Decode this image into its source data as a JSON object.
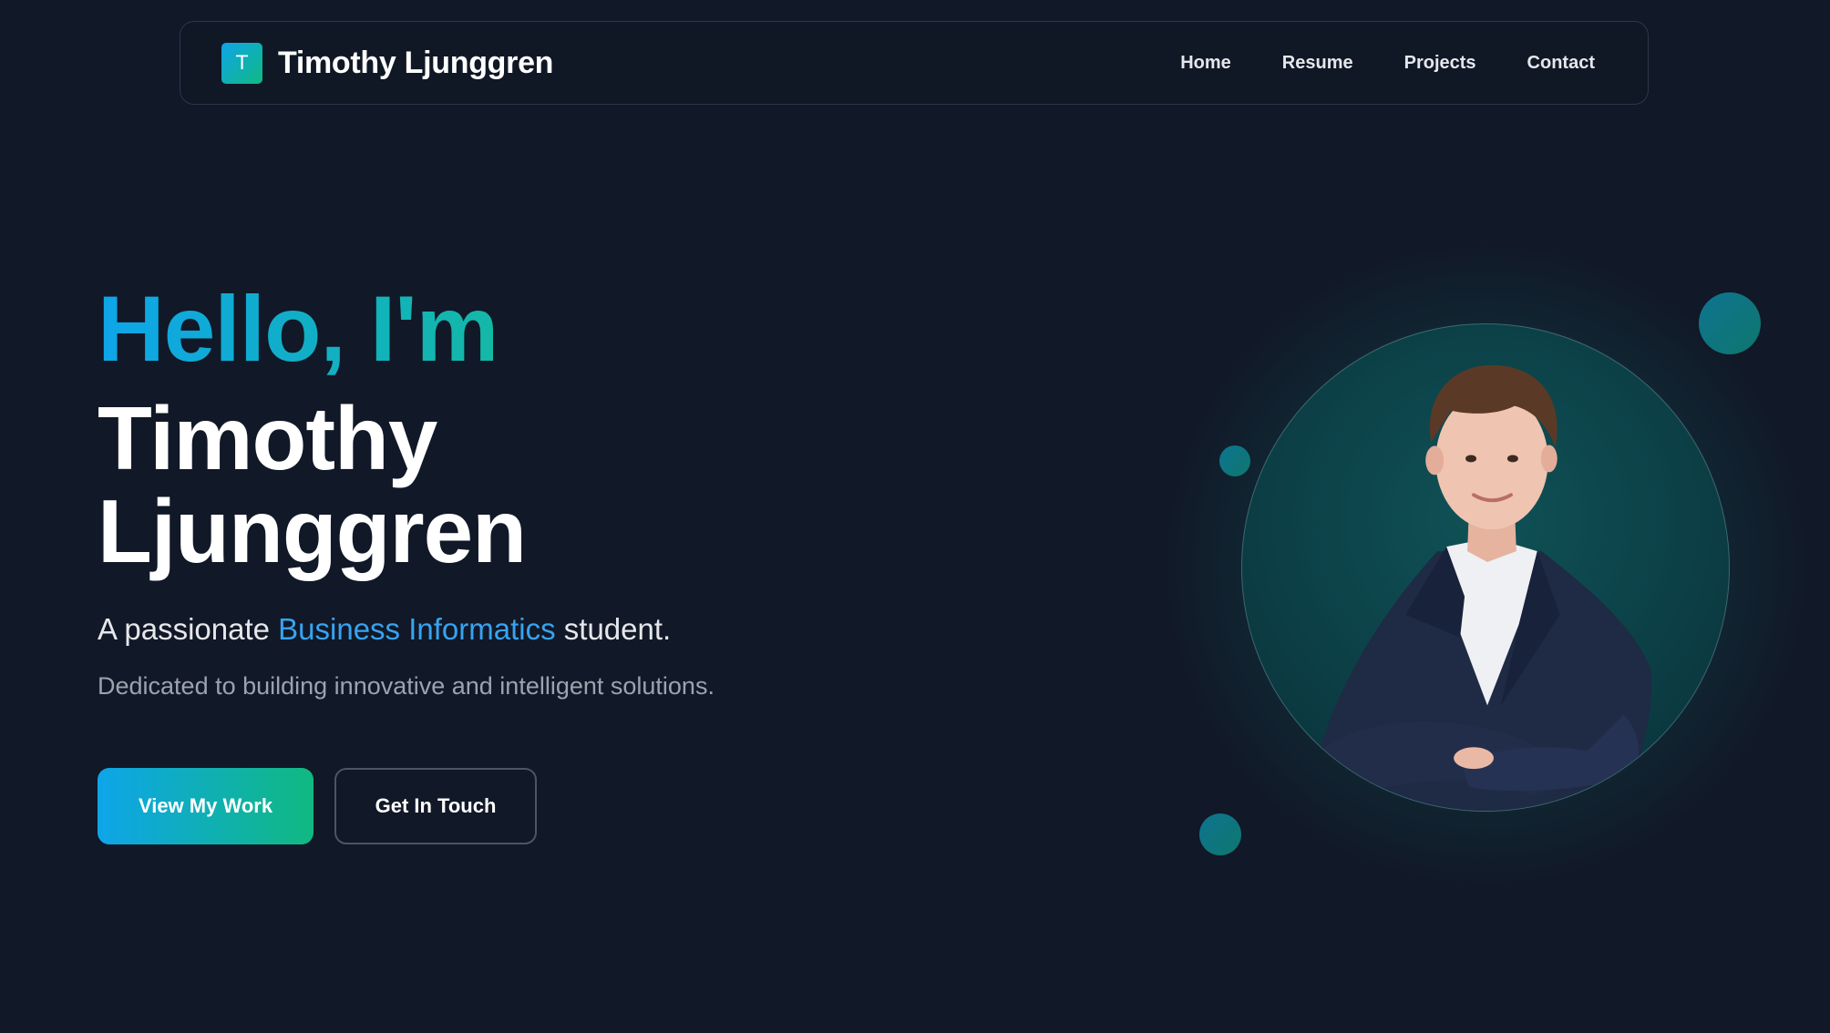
{
  "nav": {
    "logo_letter": "T",
    "brand_name": "Timothy Ljunggren",
    "links": [
      "Home",
      "Resume",
      "Projects",
      "Contact"
    ]
  },
  "hero": {
    "greeting": "Hello, I'm",
    "name_line1": "Timothy",
    "name_line2": "Ljunggren",
    "tagline_pre": "A passionate ",
    "tagline_accent": "Business Informatics",
    "tagline_post": " student.",
    "subtagline": "Dedicated to building innovative and intelligent solutions.",
    "primary_button": "View My Work",
    "secondary_button": "Get In Touch"
  },
  "colors": {
    "background": "#111827",
    "accent_blue": "#0ea5e9",
    "accent_green": "#10b981",
    "accent_teal": "#14b8a6"
  }
}
